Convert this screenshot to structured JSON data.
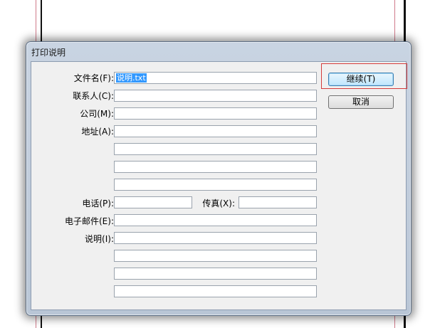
{
  "dialog": {
    "title": "打印说明",
    "labels": {
      "filename": "文件名(F):",
      "contact": "联系人(C):",
      "company": "公司(M):",
      "address": "地址(A):",
      "phone": "电话(P):",
      "fax": "传真(X):",
      "email": "电子邮件(E):",
      "notes": "说明(I):"
    },
    "fields": {
      "filename_value": "说明.txt",
      "contact_value": "",
      "company_value": "",
      "address_values": [
        "",
        "",
        "",
        ""
      ],
      "phone_value": "",
      "fax_value": "",
      "email_value": "",
      "notes_values": [
        "",
        "",
        "",
        ""
      ]
    },
    "buttons": {
      "continue": "继续(T)",
      "cancel": "取消"
    }
  },
  "colors": {
    "selection": "#3399ff",
    "highlight_box": "#d43b3b",
    "default_button": "#bee6fd"
  }
}
